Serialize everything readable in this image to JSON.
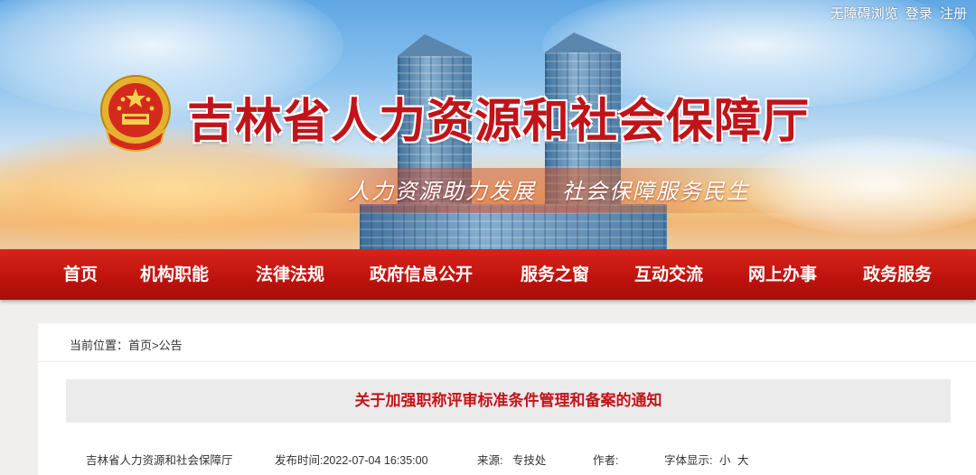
{
  "header": {
    "site_title": "吉林省人力资源和社会保障厅",
    "slogan": "人力资源助力发展   社会保障服务民生",
    "top_links": {
      "accessibility": "无障碍浏览",
      "login": "登录",
      "register": "注册"
    }
  },
  "nav": {
    "items": [
      {
        "label": "首页"
      },
      {
        "label": "机构职能"
      },
      {
        "label": "法律法规"
      },
      {
        "label": "政府信息公开"
      },
      {
        "label": "服务之窗"
      },
      {
        "label": "互动交流"
      },
      {
        "label": "网上办事"
      },
      {
        "label": "政务服务"
      }
    ]
  },
  "breadcrumb": {
    "prefix": "当前位置：",
    "home": "首页",
    "sep": ">",
    "current": "公告"
  },
  "article": {
    "title": "关于加强职称评审标准条件管理和备案的通知",
    "source_org": "吉林省人力资源和社会保障厅",
    "publish_label": "发布时间:",
    "publish_time": "2022-07-04 16:35:00",
    "origin_label": "来源:",
    "origin": "专技处",
    "author_label": "作者:",
    "author": "",
    "font_label": "字体显示:",
    "font_small": "小",
    "font_large": "大"
  },
  "colors": {
    "brand_red": "#c0141a",
    "nav_red": "#c8170f",
    "title_bg": "#ebebeb"
  }
}
